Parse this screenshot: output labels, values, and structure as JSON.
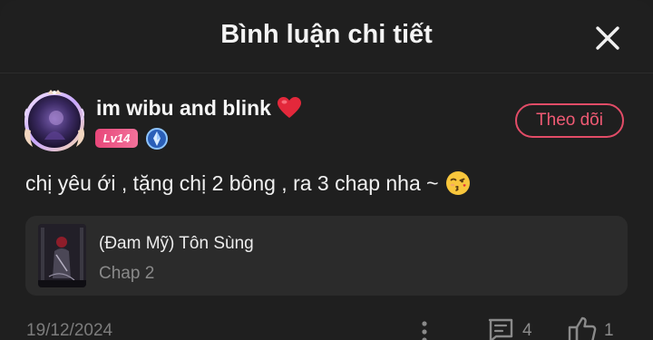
{
  "header": {
    "title": "Bình luận chi tiết",
    "close_icon": "close-icon"
  },
  "comment": {
    "author": {
      "name": "im wibu and blink",
      "name_emoji": "red-heart-icon",
      "level": "Lv14",
      "verified_icon": "verified-badge-icon",
      "avatar_icon": "avatar-with-frame"
    },
    "follow_label": "Theo dõi",
    "text": "chị yêu ới , tặng chị 2 bông , ra 3 chap nha ~",
    "text_emoji": "kissing-face-icon",
    "manga": {
      "title": "(Đam Mỹ) Tôn Sùng",
      "chapter": "Chap 2"
    },
    "date": "19/12/2024",
    "reply_count": "4",
    "like_count": "1"
  },
  "colors": {
    "background": "#1f1f1f",
    "card": "#2b2b2b",
    "accent": "#e24c67",
    "level_badge": "#ec5a86",
    "muted_text": "#7c7c7c"
  }
}
